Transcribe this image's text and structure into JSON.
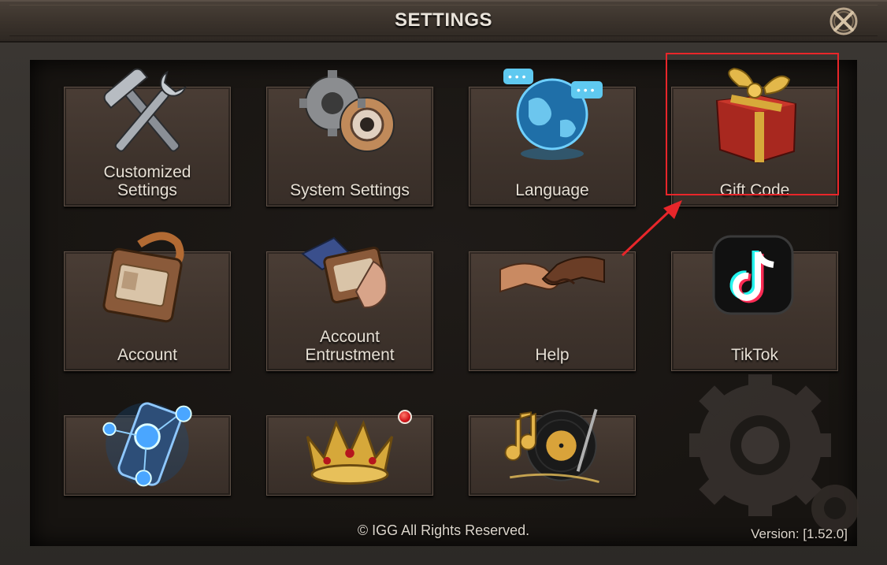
{
  "window": {
    "title": "SETTINGS"
  },
  "close_icon": "close-x-icon",
  "tiles": [
    {
      "label": "Customized\nSettings",
      "icon": "hammer-wrench-icon"
    },
    {
      "label": "System Settings",
      "icon": "gears-icon"
    },
    {
      "label": "Language",
      "icon": "globe-icon"
    },
    {
      "label": "Gift Code",
      "icon": "gift-box-icon"
    },
    {
      "label": "Account",
      "icon": "id-badge-icon"
    },
    {
      "label": "Account\nEntrustment",
      "icon": "hand-badge-icon"
    },
    {
      "label": "Help",
      "icon": "handshake-icon"
    },
    {
      "label": "TikTok",
      "icon": "tiktok-icon"
    },
    {
      "label": "",
      "icon": "phone-contacts-icon"
    },
    {
      "label": "",
      "icon": "crown-icon"
    },
    {
      "label": "",
      "icon": "vinyl-record-icon"
    }
  ],
  "footer": {
    "copyright": "© IGG All Rights Reserved.",
    "version": "Version: [1.52.0]"
  },
  "colors": {
    "highlight": "#e8262a",
    "tile_text": "#e6dfd4",
    "title_text": "#e9e3da"
  }
}
